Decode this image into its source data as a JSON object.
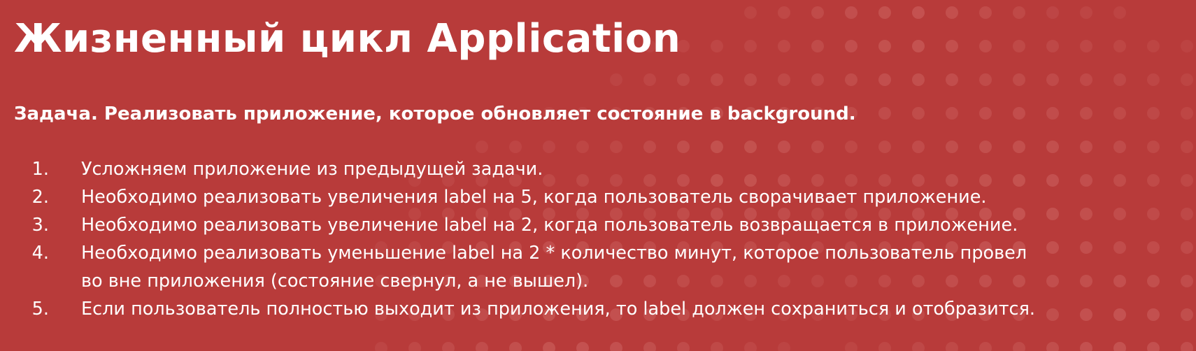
{
  "slide": {
    "title": "Жизненный цикл Application",
    "task": "Задача. Реализовать приложение, которое обновляет состояние в background.",
    "steps": [
      {
        "num": "1.",
        "lines": [
          "Усложняем приложение из предыдущей задачи."
        ]
      },
      {
        "num": "2.",
        "lines": [
          "Необходимо реализовать увеличения label на 5, когда пользователь сворачивает приложение."
        ]
      },
      {
        "num": "3.",
        "lines": [
          "Необходимо реализовать увеличение label на 2, когда пользователь возвращается в приложение."
        ]
      },
      {
        "num": "4.",
        "lines": [
          "Необходимо реализовать уменьшение label на 2 * количество минут, которое пользователь провел",
          "во вне приложения (состояние свернул, а не вышел)."
        ]
      },
      {
        "num": "5.",
        "lines": [
          "Если пользователь полностью выходит из приложения, то label должен сохраниться и отобразится."
        ]
      }
    ]
  },
  "colors": {
    "background": "#b83b3a",
    "text": "#ffffff",
    "dots": "#c85a58"
  }
}
